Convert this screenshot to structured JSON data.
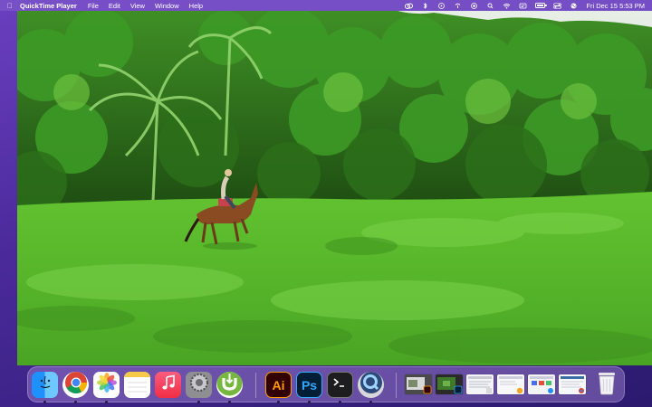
{
  "menubar": {
    "app_name": "QuickTime Player",
    "menus": [
      "File",
      "Edit",
      "View",
      "Window",
      "Help"
    ],
    "clock": "Fri Dec 15  5:53 PM"
  },
  "dock": {
    "apps": [
      {
        "name": "Finder",
        "icon": "finder-icon",
        "running": true
      },
      {
        "name": "Google Chrome",
        "icon": "chrome-icon",
        "running": true
      },
      {
        "name": "Photos",
        "icon": "photos-icon",
        "running": true
      },
      {
        "name": "Notes",
        "icon": "notes-icon",
        "running": false
      },
      {
        "name": "Music",
        "icon": "music-icon",
        "running": false
      },
      {
        "name": "System Settings",
        "icon": "settings-icon",
        "running": false
      },
      {
        "name": "uTorrent",
        "icon": "utorrent-icon",
        "running": true
      },
      {
        "name": "Adobe Illustrator",
        "icon": "illustrator-icon",
        "label": "Ai",
        "running": true
      },
      {
        "name": "Adobe Photoshop",
        "icon": "photoshop-icon",
        "label": "Ps",
        "running": true
      },
      {
        "name": "Terminal",
        "icon": "terminal-icon",
        "running": true
      },
      {
        "name": "QuickTime Player",
        "icon": "quicktime-icon",
        "running": true
      }
    ],
    "minimized_windows": 6,
    "trash": {
      "name": "Trash",
      "icon": "trash-icon"
    }
  },
  "colors": {
    "menubar": "#7850c8",
    "grass": "#55b82c",
    "forest": "#2f7a1e"
  }
}
